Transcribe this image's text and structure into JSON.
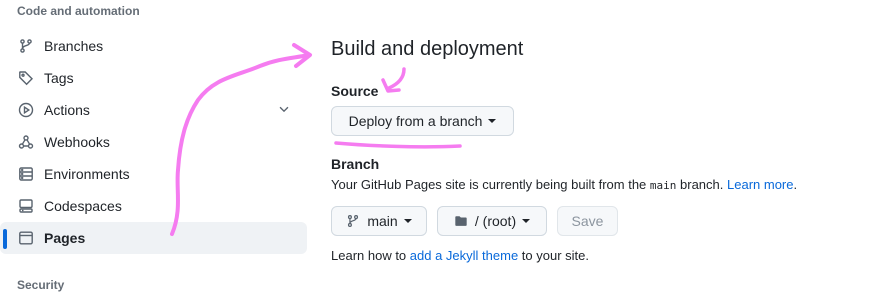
{
  "sidebar": {
    "section_title": "Code and automation",
    "next_section_title": "Security",
    "items": [
      {
        "label": "Branches",
        "icon": "git-branch-icon"
      },
      {
        "label": "Tags",
        "icon": "tag-icon"
      },
      {
        "label": "Actions",
        "icon": "play-icon"
      },
      {
        "label": "Webhooks",
        "icon": "webhook-icon"
      },
      {
        "label": "Environments",
        "icon": "server-icon"
      },
      {
        "label": "Codespaces",
        "icon": "codespaces-icon"
      },
      {
        "label": "Pages",
        "icon": "browser-icon",
        "active": true
      }
    ]
  },
  "main": {
    "heading": "Build and deployment",
    "source_label": "Source",
    "source_button": "Deploy from a branch",
    "branch_label": "Branch",
    "branch_desc_prefix": "Your GitHub Pages site is currently being built from the ",
    "branch_desc_code": "main",
    "branch_desc_suffix": " branch. ",
    "learn_more": "Learn more",
    "branch_button": "main",
    "folder_button": "/ (root)",
    "save_button": "Save",
    "jekyll_prefix": "Learn how to ",
    "jekyll_link": "add a Jekyll theme",
    "jekyll_suffix": " to your site."
  },
  "colors": {
    "accent": "#0969da",
    "annotation": "#f57cf0"
  }
}
